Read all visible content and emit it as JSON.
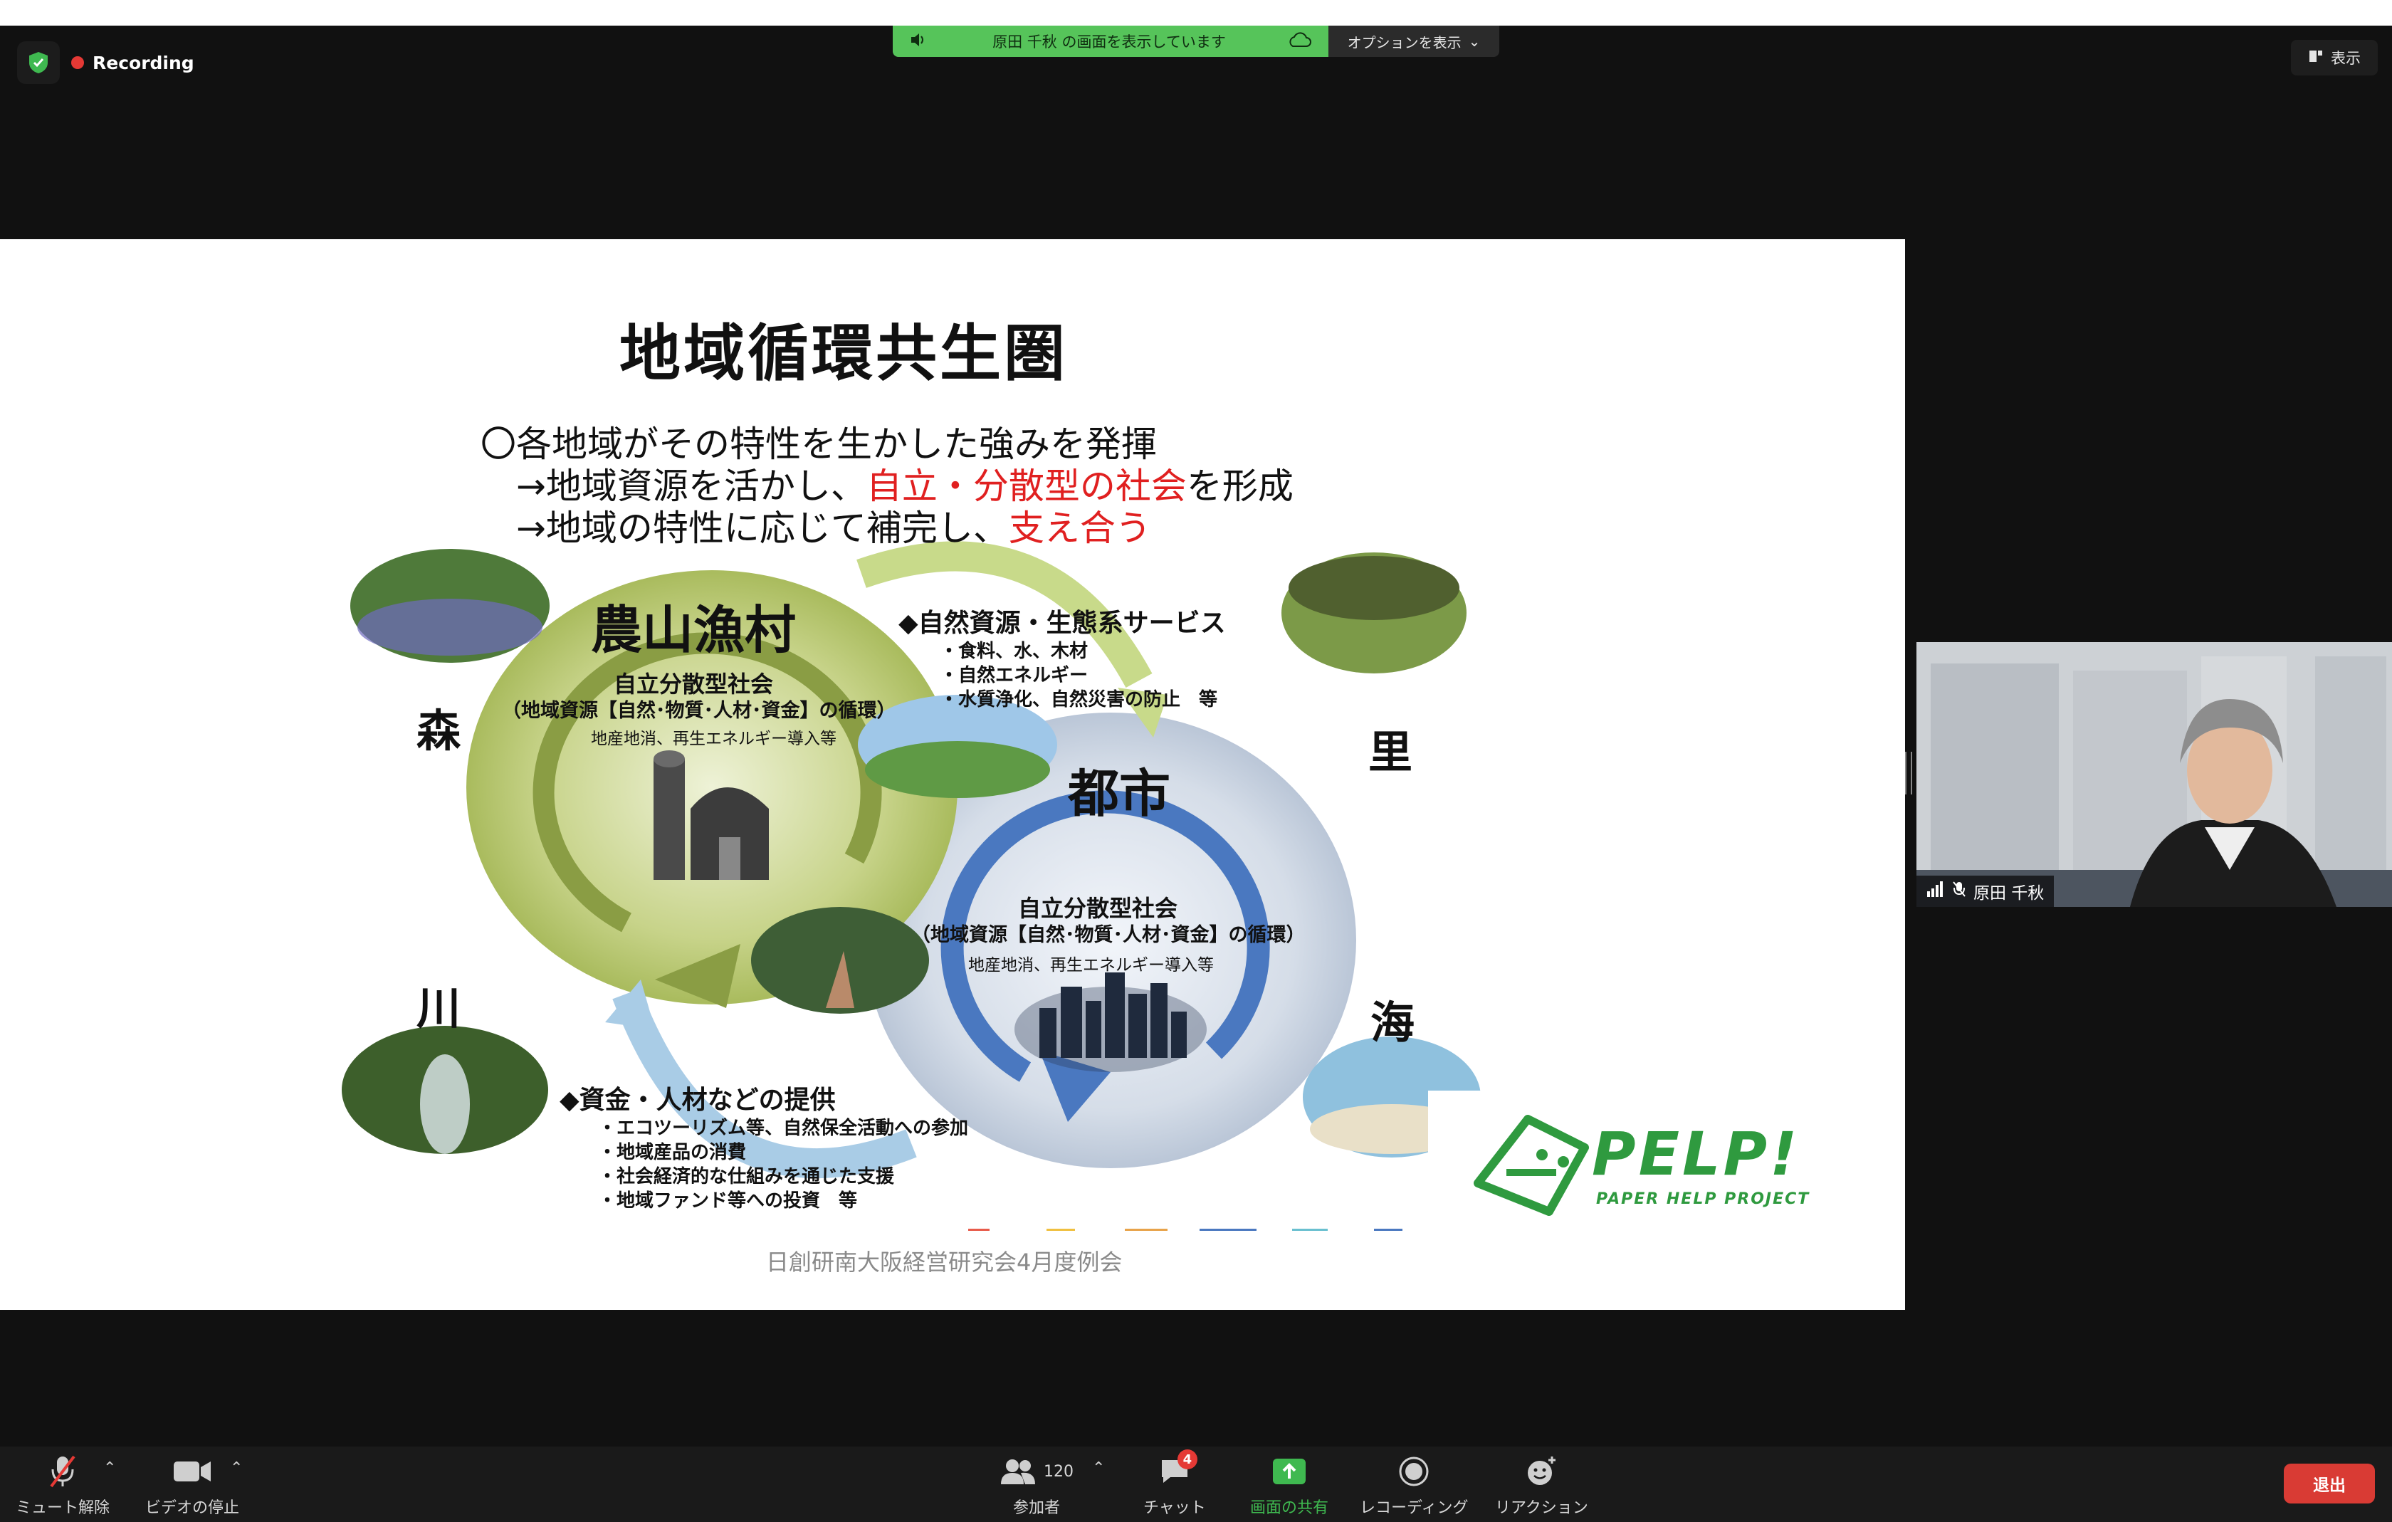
{
  "topbar": {
    "recording_label": "Recording",
    "share_banner": "原田 千秋 の画面を表示しています",
    "options_label": "オプションを表示",
    "view_label": "表示"
  },
  "slide": {
    "title": "地域循環共生圏",
    "line1": "〇各地域がその特性を生かした強みを発揮",
    "line2_prefix": "→地域資源を活かし、",
    "line2_red": "自立・分散型の社会",
    "line2_suffix": "を形成",
    "line3_prefix": "→地域の特性に応じて補完し、",
    "line3_red": "支え合う",
    "rural_title": "農山漁村",
    "rural_sub1": "自立分散型社会",
    "rural_sub2": "（地域資源【自然･物質･人材･資金】の循環）",
    "rural_sub3": "地産地消、再生エネルギー導入等",
    "urban_title": "都市",
    "urban_sub1": "自立分散型社会",
    "urban_sub2": "（地域資源【自然･物質･人材･資金】の循環）",
    "urban_sub3": "地産地消、再生エネルギー導入等",
    "forest": "森",
    "village": "里",
    "river": "川",
    "sea": "海",
    "nature_head": "◆自然資源・生態系サービス",
    "nature_items": [
      "・食料、水、木材",
      "・自然エネルギー",
      "・水質浄化、自然災害の防止　等"
    ],
    "funds_head": "◆資金・人材などの提供",
    "funds_items": [
      "・エコツーリズム等、自然保全活動への参加",
      "・地域産品の消費",
      "・社会経済的な仕組みを通じた支援",
      "・地域ファンド等への投資　等"
    ],
    "footer": "日創研南大阪経営研究会4月度例会",
    "logo_name": "PELP!",
    "logo_sub": "PAPER HELP PROJECT"
  },
  "participant": {
    "name": "原田 千秋"
  },
  "toolbar": {
    "mute": "ミュート解除",
    "video": "ビデオの停止",
    "participants": "参加者",
    "participants_count": "120",
    "chat": "チャット",
    "chat_badge": "4",
    "share": "画面の共有",
    "record": "レコーディング",
    "reactions": "リアクション",
    "leave": "退出"
  },
  "colors": {
    "share_green": "#56c45a",
    "leave_red": "#d93b34",
    "rural_green": "#8a9d44",
    "urban_blue": "#4a78c0",
    "accent_red": "#e02020"
  }
}
